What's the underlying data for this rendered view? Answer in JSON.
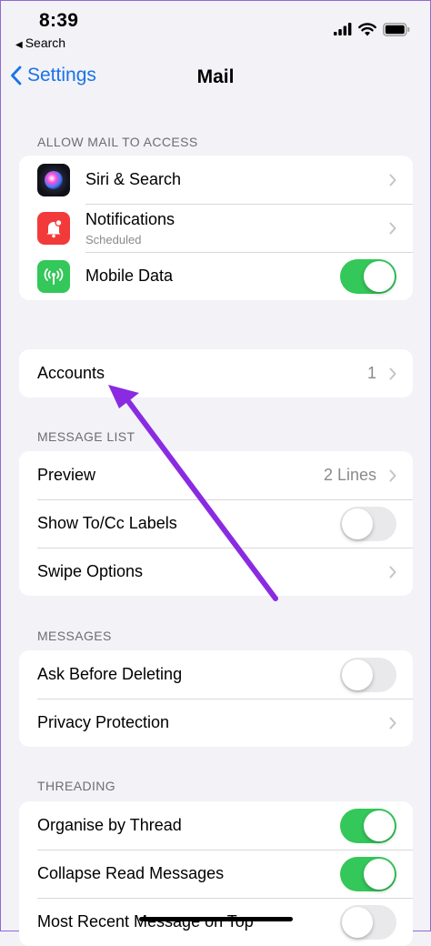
{
  "status_bar": {
    "time": "8:39",
    "back_app": "Search"
  },
  "nav": {
    "back_label": "Settings",
    "title": "Mail"
  },
  "sections": {
    "allow_access": {
      "header": "ALLOW MAIL TO ACCESS",
      "siri": {
        "label": "Siri & Search"
      },
      "notifications": {
        "label": "Notifications",
        "sub": "Scheduled"
      },
      "mobile_data": {
        "label": "Mobile Data",
        "on": true
      }
    },
    "accounts": {
      "label": "Accounts",
      "value": "1"
    },
    "message_list": {
      "header": "MESSAGE LIST",
      "preview": {
        "label": "Preview",
        "value": "2 Lines"
      },
      "show_tocc": {
        "label": "Show To/Cc Labels",
        "on": false
      },
      "swipe": {
        "label": "Swipe Options"
      }
    },
    "messages": {
      "header": "MESSAGES",
      "ask_delete": {
        "label": "Ask Before Deleting",
        "on": false
      },
      "privacy": {
        "label": "Privacy Protection"
      }
    },
    "threading": {
      "header": "THREADING",
      "organise": {
        "label": "Organise by Thread",
        "on": true
      },
      "collapse": {
        "label": "Collapse Read Messages",
        "on": true
      },
      "most_recent": {
        "label": "Most Recent Message on Top",
        "on": false
      }
    }
  },
  "colors": {
    "accent": "#1a73e8",
    "toggle_on": "#34c759",
    "annotation_arrow": "#8a2be2",
    "notifications_icon": "#f23a3a",
    "mobile_data_icon": "#34c759"
  },
  "icons": {
    "siri": "siri-orb",
    "notifications": "bell-badge",
    "mobile_data": "antenna-signal",
    "chevron": "chevron-right"
  }
}
